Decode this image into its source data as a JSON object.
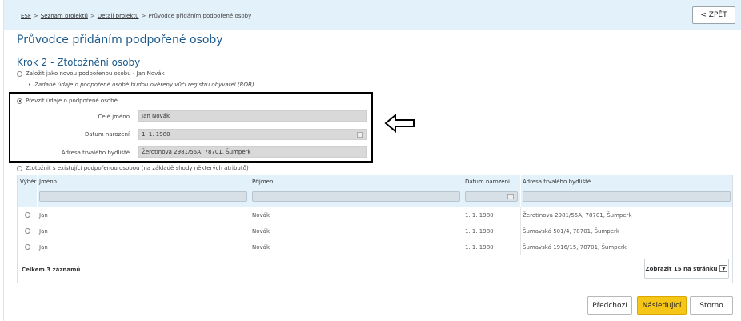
{
  "breadcrumb": {
    "items": [
      "ESF",
      "Seznam projektů",
      "Detail projektu"
    ],
    "current": "Průvodce přidáním podpořené osoby",
    "separator": ">"
  },
  "back_button": "< ZPĚT",
  "page_title": "Průvodce přidáním podpořené osoby",
  "step_title": "Krok 2 - Ztotožnění osoby",
  "options": {
    "create_new": "Založit jako novou podpořenou osobu - Jan Novák",
    "create_new_note": "Zadané údaje o podpořené osobě budou ověřeny vůči registru obyvatel (ROB)",
    "take_over": "Převzít údaje o podpořené osobě",
    "match_existing": "Ztotožnit s existující podpořenou osobou (na základě shody některých atributů)"
  },
  "person_form": {
    "full_name_label": "Celé jméno",
    "full_name_value": "Jan Novák",
    "birth_date_label": "Datum narození",
    "birth_date_value": "1. 1. 1980",
    "address_label": "Adresa trvalého bydliště",
    "address_value": "Žerotínova 2981/55A, 78701, Šumperk"
  },
  "grid": {
    "columns": [
      "Výběr",
      "Jméno",
      "Příjmení",
      "Datum narození",
      "Adresa trvalého bydliště"
    ],
    "rows": [
      {
        "first": "Jan",
        "last": "Novák",
        "dob": "1. 1. 1980",
        "address": "Žerotínova 2981/55A, 78701, Šumperk"
      },
      {
        "first": "Jan",
        "last": "Novák",
        "dob": "1. 1. 1980",
        "address": "Šumavská 501/4, 78701, Šumperk"
      },
      {
        "first": "Jan",
        "last": "Novák",
        "dob": "1. 1. 1980",
        "address": "Šumavská 1916/15, 78701, Šumperk"
      }
    ],
    "total": "Celkem 3 záznamů",
    "page_size": "Zobrazit 15 na stránku"
  },
  "buttons": {
    "prev": "Předchozí",
    "next": "Následující",
    "cancel": "Storno"
  },
  "colors": {
    "header_bg": "#e3f1fb",
    "title": "#1c5a8c",
    "primary": "#f5c518"
  },
  "icons": {
    "arrow": "left-arrow-icon",
    "calendar": "calendar-icon",
    "dropdown": "chevron-down-icon"
  }
}
